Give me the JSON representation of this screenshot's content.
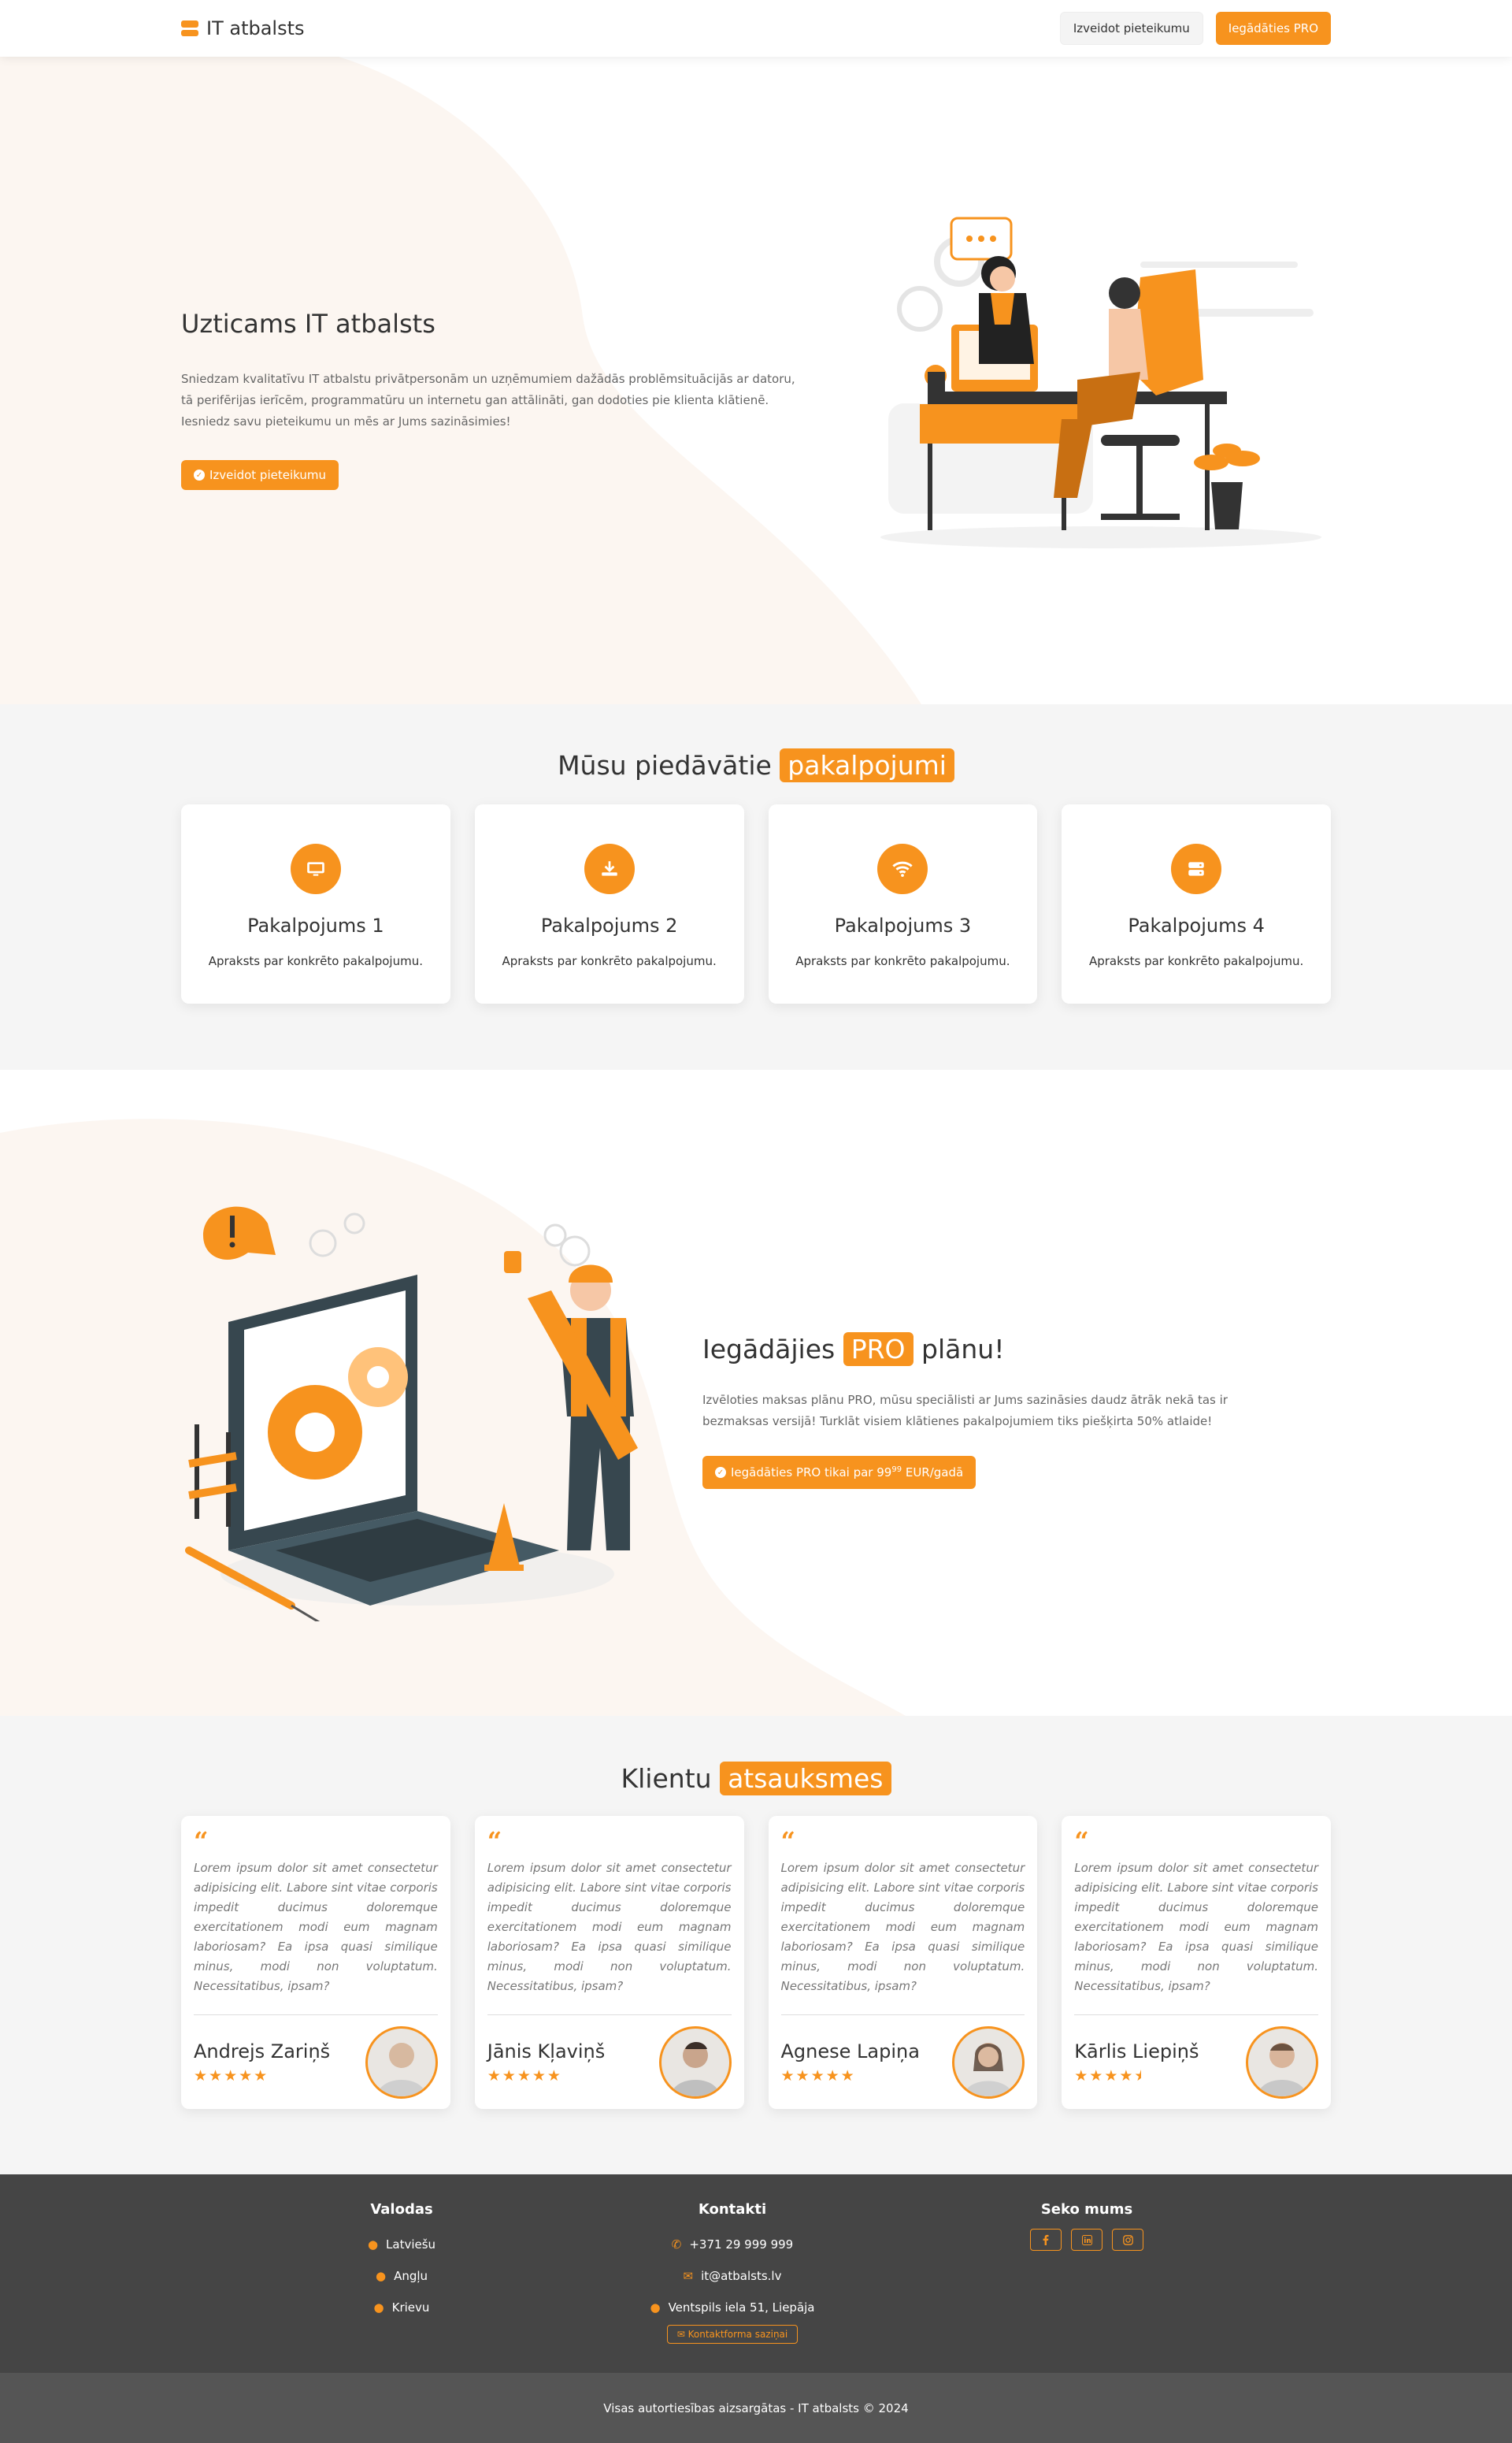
{
  "nav": {
    "brand": "IT atbalsts",
    "create_request": "Izveidot pieteikumu",
    "buy_pro": "Iegādāties PRO"
  },
  "hero": {
    "title": "Uzticams IT atbalsts",
    "description": "Sniedzam kvalitatīvu IT atbalstu privātpersonām un uzņēmumiem dažādās problēmsituācijās ar datoru, tā perifērijas ierīcēm, programmatūru un internetu gan attālināti, gan dodoties pie klienta klātienē. Iesniedz savu pieteikumu un mēs ar Jums sazināsimies!",
    "cta": "Izveidot pieteikumu"
  },
  "services": {
    "title_prefix": "Mūsu piedāvātie",
    "title_highlight": "pakalpojumi",
    "items": [
      {
        "icon": "monitor-icon",
        "title": "Pakalpojums 1",
        "text": "Apraksts par konkrēto pakalpojumu."
      },
      {
        "icon": "download-icon",
        "title": "Pakalpojums 2",
        "text": "Apraksts par konkrēto pakalpojumu."
      },
      {
        "icon": "wifi-icon",
        "title": "Pakalpojums 3",
        "text": "Apraksts par konkrēto pakalpojumu."
      },
      {
        "icon": "server-icon",
        "title": "Pakalpojums 4",
        "text": "Apraksts par konkrēto pakalpojumu."
      }
    ]
  },
  "pro": {
    "title_prefix": "Iegādājies",
    "title_highlight": "PRO",
    "title_suffix": "plānu!",
    "description": "Izvēloties maksas plānu PRO, mūsu speciālisti ar Jums sazināsies daudz ātrāk nekā tas ir bezmaksas versijā! Turklāt visiem klātienes pakalpojumiem tiks piešķirta 50% atlaide!",
    "cta_prefix": "Iegādāties PRO tikai par 99",
    "cta_sup": "99",
    "cta_suffix": "EUR/gadā"
  },
  "testimonials": {
    "title_prefix": "Klientu",
    "title_highlight": "atsauksmes",
    "items": [
      {
        "text": "Lorem ipsum dolor sit amet consectetur adipisicing elit. Labore sint vitae corporis impedit ducimus doloremque exercitationem modi eum magnam laboriosam? Ea ipsa quasi similique minus, modi non voluptatum. Necessitatibus, ipsam?",
        "name": "Andrejs Zariņš",
        "rating": 5
      },
      {
        "text": "Lorem ipsum dolor sit amet consectetur adipisicing elit. Labore sint vitae corporis impedit ducimus doloremque exercitationem modi eum magnam laboriosam? Ea ipsa quasi similique minus, modi non voluptatum. Necessitatibus, ipsam?",
        "name": "Jānis Kļaviņš",
        "rating": 5
      },
      {
        "text": "Lorem ipsum dolor sit amet consectetur adipisicing elit. Labore sint vitae corporis impedit ducimus doloremque exercitationem modi eum magnam laboriosam? Ea ipsa quasi similique minus, modi non voluptatum. Necessitatibus, ipsam?",
        "name": "Agnese Lapiņa",
        "rating": 5
      },
      {
        "text": "Lorem ipsum dolor sit amet consectetur adipisicing elit. Labore sint vitae corporis impedit ducimus doloremque exercitationem modi eum magnam laboriosam? Ea ipsa quasi similique minus, modi non voluptatum. Necessitatibus, ipsam?",
        "name": "Kārlis Liepiņš",
        "rating": 4.5
      }
    ]
  },
  "footer": {
    "languages_title": "Valodas",
    "languages": [
      "Latviešu",
      "Angļu",
      "Krievu"
    ],
    "contacts_title": "Kontakti",
    "phone": "+371 29 999 999",
    "email": "it@atbalsts.lv",
    "address": "Ventspils iela 51, Liepāja",
    "contact_form": "Kontaktforma saziņai",
    "follow_title": "Seko mums",
    "social": [
      "facebook-icon",
      "linkedin-icon",
      "instagram-icon"
    ],
    "copyright": "Visas autortiesības aizsargātas - IT atbalsts © 2024"
  },
  "colors": {
    "accent": "#f7931e",
    "footer_bg": "#454545",
    "copyright_bg": "#555555",
    "section_bg": "#f5f5f5"
  }
}
